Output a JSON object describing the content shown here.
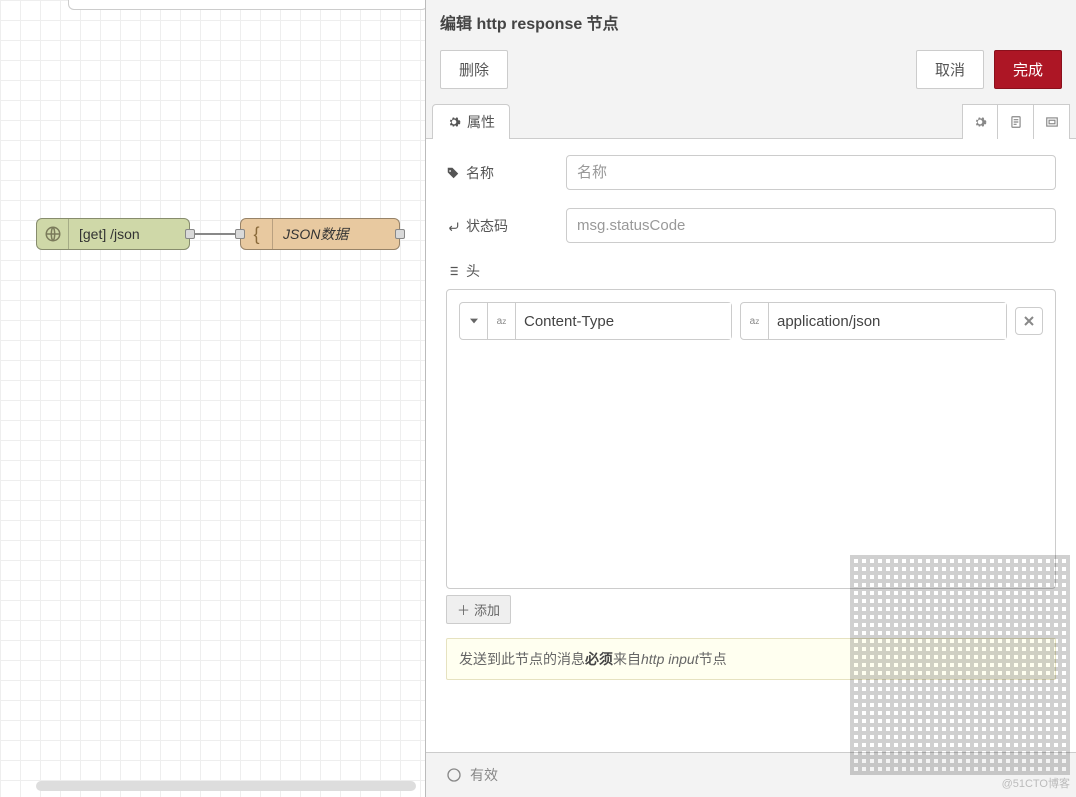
{
  "workspace": {
    "nodes": {
      "http_in": {
        "label": "[get] /json"
      },
      "json": {
        "label": "JSON数据"
      }
    }
  },
  "panel": {
    "title": "编辑 http response 节点",
    "delete_label": "删除",
    "cancel_label": "取消",
    "done_label": "完成",
    "properties_tab": "属性",
    "form": {
      "name_label": "名称",
      "name_placeholder": "名称",
      "name_value": "",
      "status_label": "状态码",
      "status_placeholder": "msg.statusCode",
      "status_value": "",
      "headers_label": "头",
      "headers": [
        {
          "key": "Content-Type",
          "val": "application/json"
        }
      ],
      "add_label": "添加",
      "tip_pre": "发送到此节点的消息",
      "tip_bold": "必须",
      "tip_mid": "来自",
      "tip_italic": "http input",
      "tip_post": "节点"
    },
    "footer": {
      "toggle_label": "有效"
    }
  },
  "watermark": "@51CTO博客"
}
